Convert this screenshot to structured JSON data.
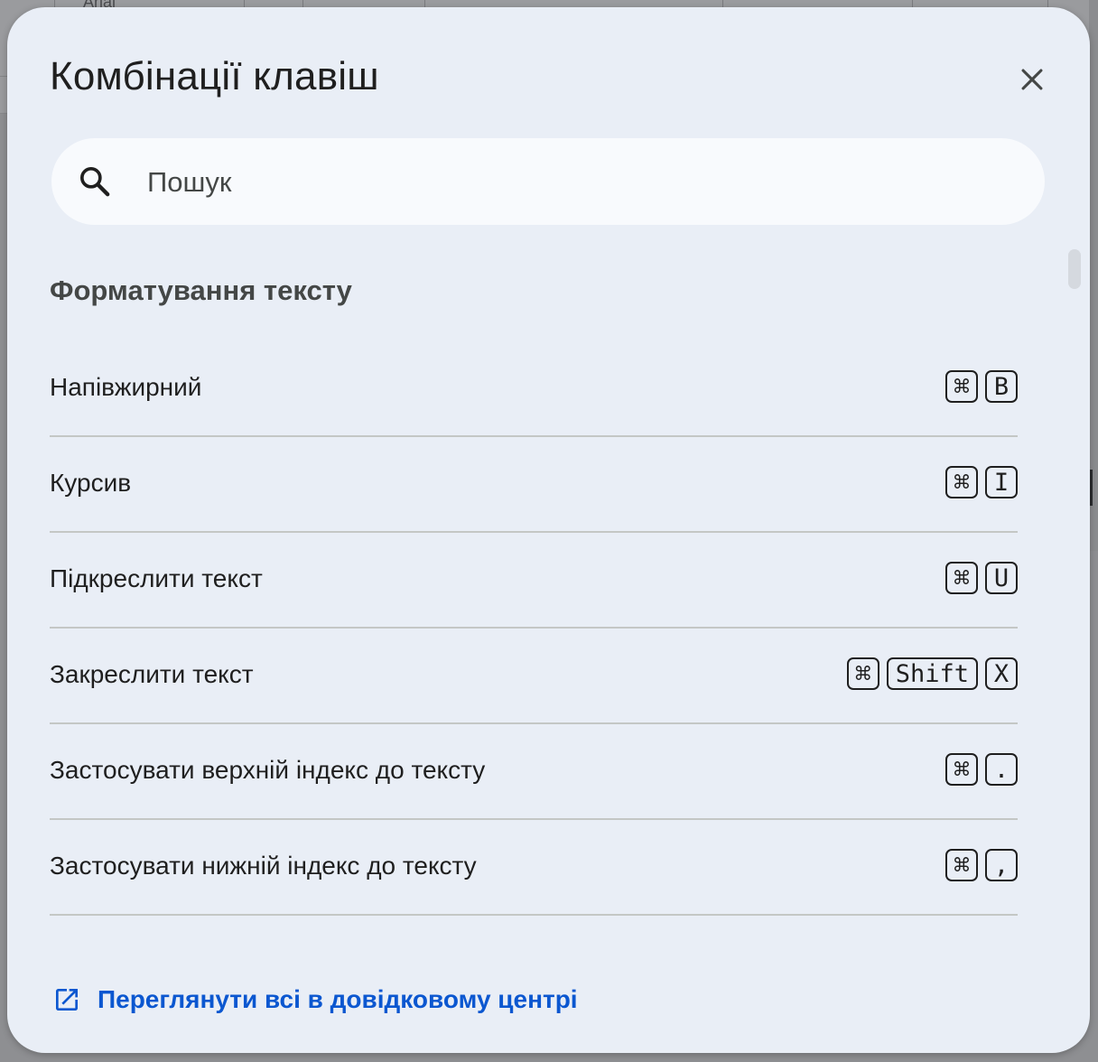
{
  "background": {
    "toolbar_partial_text": "Arial"
  },
  "dialog": {
    "title": "Комбінації клавіш",
    "close_icon": "close-icon",
    "search": {
      "placeholder": "Пошук",
      "value": "",
      "icon": "search-icon"
    },
    "section": {
      "heading": "Форматування тексту",
      "shortcuts": [
        {
          "label": "Напівжирний",
          "keys": [
            "⌘",
            "B"
          ]
        },
        {
          "label": "Курсив",
          "keys": [
            "⌘",
            "I"
          ]
        },
        {
          "label": "Підкреслити текст",
          "keys": [
            "⌘",
            "U"
          ]
        },
        {
          "label": "Закреслити текст",
          "keys": [
            "⌘",
            "Shift",
            "X"
          ]
        },
        {
          "label": "Застосувати верхній індекс до тексту",
          "keys": [
            "⌘",
            "."
          ]
        },
        {
          "label": "Застосувати нижній індекс до тексту",
          "keys": [
            "⌘",
            ","
          ]
        }
      ]
    },
    "help_link": {
      "label": "Переглянути всі в довідковому центрі",
      "icon": "open-in-new-icon"
    }
  },
  "colors": {
    "dialog_bg": "#e9eef6",
    "search_bg": "#f8fafd",
    "link": "#0b57d0",
    "text_primary": "#1f1f1f",
    "text_secondary": "#444746",
    "divider": "#c4c7c5"
  }
}
